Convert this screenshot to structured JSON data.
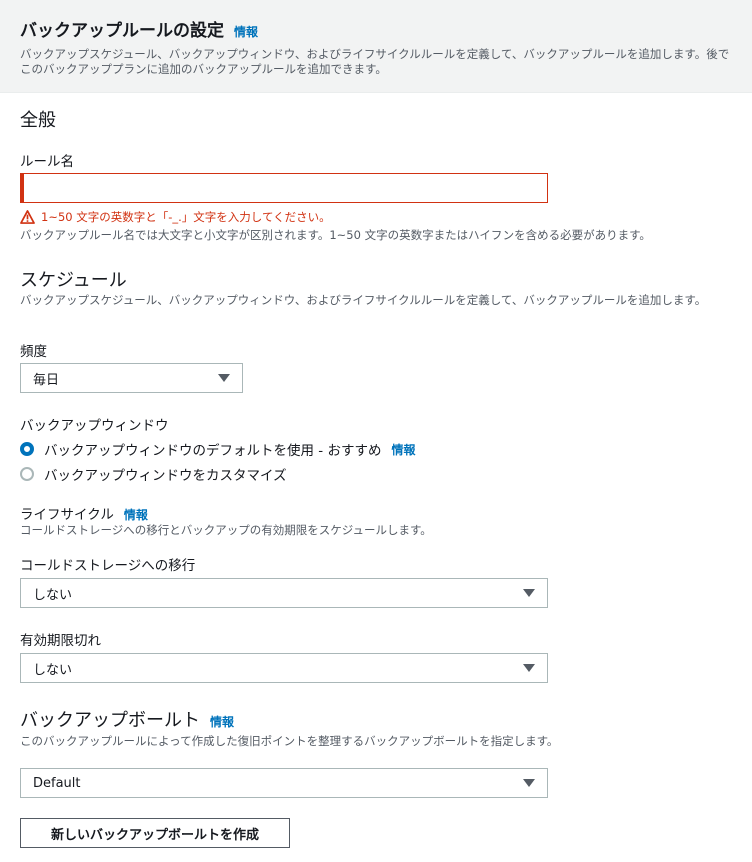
{
  "header": {
    "title": "バックアップルールの設定",
    "info": "情報",
    "description": "バックアップスケジュール、バックアップウィンドウ、およびライフサイクルルールを定義して、バックアップルールを追加します。後でこのバックアッププランに追加のバックアップルールを追加できます。"
  },
  "general": {
    "title": "全般",
    "rule_name_label": "ルール名",
    "rule_name_value": "",
    "rule_name_error": "1~50 文字の英数字と「-_.」文字を入力してください。",
    "rule_name_hint": "バックアップルール名では大文字と小文字が区別されます。1~50 文字の英数字またはハイフンを含める必要があります。"
  },
  "schedule": {
    "title": "スケジュール",
    "description": "バックアップスケジュール、バックアップウィンドウ、およびライフサイクルルールを定義して、バックアップルールを追加します。",
    "frequency_label": "頻度",
    "frequency_value": "毎日",
    "window_label": "バックアップウィンドウ",
    "window_options": [
      {
        "label": "バックアップウィンドウのデフォルトを使用 - おすすめ",
        "checked": true,
        "info": "情報"
      },
      {
        "label": "バックアップウィンドウをカスタマイズ",
        "checked": false
      }
    ],
    "lifecycle_label": "ライフサイクル",
    "lifecycle_info": "情報",
    "lifecycle_description": "コールドストレージへの移行とバックアップの有効期限をスケジュールします。",
    "cold_storage_label": "コールドストレージへの移行",
    "cold_storage_value": "しない",
    "expiration_label": "有効期限切れ",
    "expiration_value": "しない"
  },
  "vault": {
    "title": "バックアップボールト",
    "info": "情報",
    "description": "このバックアップルールによって作成した復旧ポイントを整理するバックアップボールトを指定します。",
    "value": "Default",
    "create_button": "新しいバックアップボールトを作成"
  },
  "colors": {
    "accent": "#0073bb",
    "error": "#d13212",
    "text": "#16191f",
    "muted": "#545b64"
  }
}
